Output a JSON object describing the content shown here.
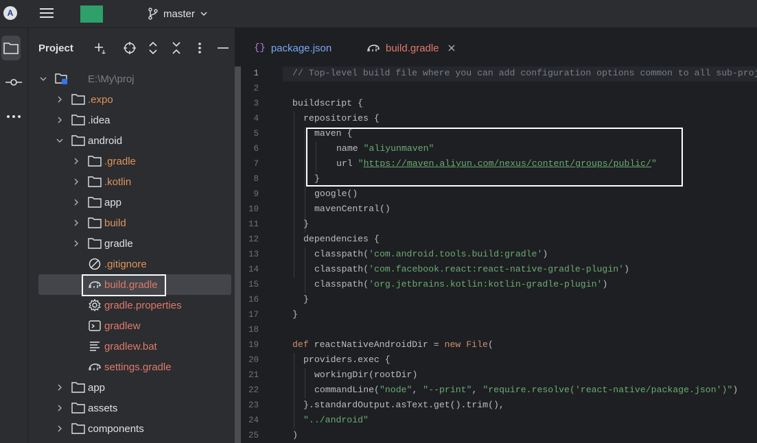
{
  "titlebar": {
    "app_logo": "A",
    "branch": "master"
  },
  "project_panel": {
    "title": "Project",
    "tree": [
      {
        "label": "E:\\My\\proj",
        "kind": "root",
        "expanded": true
      },
      {
        "label": ".expo",
        "kind": "folder"
      },
      {
        "label": ".idea",
        "kind": "folder"
      },
      {
        "label": "android",
        "kind": "folder",
        "expanded": true
      },
      {
        "label": ".gradle",
        "kind": "folder"
      },
      {
        "label": ".kotlin",
        "kind": "folder"
      },
      {
        "label": "app",
        "kind": "folder"
      },
      {
        "label": "build",
        "kind": "folder"
      },
      {
        "label": "gradle",
        "kind": "folder"
      },
      {
        "label": ".gitignore",
        "kind": "file"
      },
      {
        "label": "build.gradle",
        "kind": "file",
        "selected": true
      },
      {
        "label": "gradle.properties",
        "kind": "file"
      },
      {
        "label": "gradlew",
        "kind": "file"
      },
      {
        "label": "gradlew.bat",
        "kind": "file"
      },
      {
        "label": "settings.gradle",
        "kind": "file"
      },
      {
        "label": "app",
        "kind": "folder"
      },
      {
        "label": "assets",
        "kind": "folder"
      },
      {
        "label": "components",
        "kind": "folder"
      }
    ]
  },
  "editor": {
    "tabs": [
      {
        "label": "package.json",
        "active": false
      },
      {
        "label": "build.gradle",
        "active": true
      }
    ],
    "line_numbers": [
      "1",
      "2",
      "3",
      "4",
      "5",
      "6",
      "7",
      "8",
      "9",
      "10",
      "11",
      "12",
      "13",
      "14",
      "15",
      "16",
      "17",
      "18",
      "19",
      "20",
      "21",
      "22",
      "23",
      "24",
      "25"
    ],
    "code": {
      "l1": "// Top-level build file where you can add configuration options common to all sub-projects/modules.",
      "l3_kw": "buildscript",
      "l3_rest": " {",
      "l4": "repositories {",
      "l5": "maven {",
      "l6_a": "name ",
      "l6_s": "\"aliyunmaven\"",
      "l7_a": "url ",
      "l7_q1": "\"",
      "l7_url": "https://maven.aliyun.com/nexus/content/groups/public/",
      "l7_q2": "\"",
      "l8": "}",
      "l9": "google()",
      "l10": "mavenCentral()",
      "l11": "}",
      "l12": "dependencies {",
      "l13_a": "classpath(",
      "l13_s": "'com.android.tools.build:gradle'",
      "l13_b": ")",
      "l14_a": "classpath(",
      "l14_s": "'com.facebook.react:react-native-gradle-plugin'",
      "l14_b": ")",
      "l15_a": "classpath(",
      "l15_s": "'org.jetbrains.kotlin:kotlin-gradle-plugin'",
      "l15_b": ")",
      "l16": "}",
      "l17": "}",
      "l19_kw": "def",
      "l19_a": " reactNativeAndroidDir = ",
      "l19_kw2": "new",
      "l19_cls": " File",
      "l19_b": "(",
      "l20": "providers.exec {",
      "l21": "workingDir(rootDir)",
      "l22_a": "commandLine(",
      "l22_s1": "\"node\"",
      "l22_c1": ", ",
      "l22_s2": "\"--print\"",
      "l22_c2": ", ",
      "l22_s3": "\"require.resolve('react-native/package.json')\"",
      "l22_b": ")",
      "l23": "}.standardOutput.asText.get().trim(),",
      "l24": "\"../android\"",
      "l25": ")"
    }
  }
}
